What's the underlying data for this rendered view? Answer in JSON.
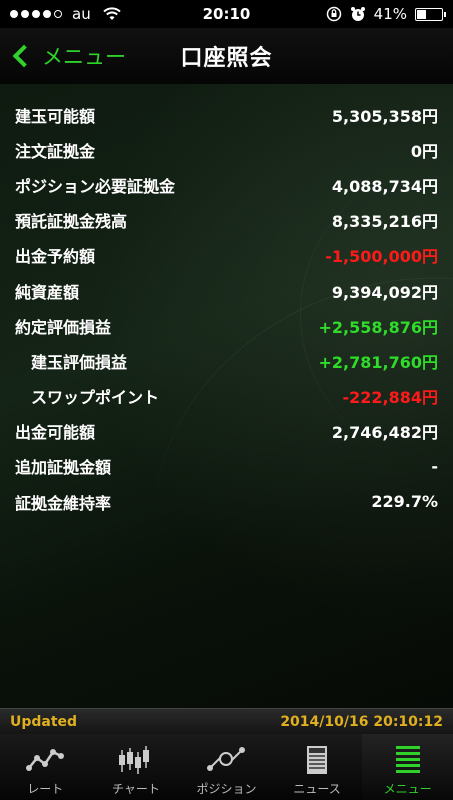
{
  "status": {
    "carrier": "au",
    "time": "20:10",
    "battery": "41%",
    "battery_level": 0.41
  },
  "nav": {
    "back_label": "メニュー",
    "title": "口座照会"
  },
  "rows": [
    {
      "label": "建玉可能額",
      "value": "5,305,358円",
      "color": "white",
      "indent": false
    },
    {
      "label": "注文証拠金",
      "value": "0円",
      "color": "white",
      "indent": false
    },
    {
      "label": "ポジション必要証拠金",
      "value": "4,088,734円",
      "color": "white",
      "indent": false
    },
    {
      "label": "預託証拠金残高",
      "value": "8,335,216円",
      "color": "white",
      "indent": false
    },
    {
      "label": "出金予約額",
      "value": "-1,500,000円",
      "color": "red",
      "indent": false
    },
    {
      "label": "純資産額",
      "value": "9,394,092円",
      "color": "white",
      "indent": false
    },
    {
      "label": "約定評価損益",
      "value": "+2,558,876円",
      "color": "green",
      "indent": false
    },
    {
      "label": "建玉評価損益",
      "value": "+2,781,760円",
      "color": "green",
      "indent": true
    },
    {
      "label": "スワップポイント",
      "value": "-222,884円",
      "color": "red",
      "indent": true
    },
    {
      "label": "出金可能額",
      "value": "2,746,482円",
      "color": "white",
      "indent": false
    },
    {
      "label": "追加証拠金額",
      "value": "-",
      "color": "white",
      "indent": false
    },
    {
      "label": "証拠金維持率",
      "value": "229.7%",
      "color": "white",
      "indent": false
    }
  ],
  "updated": {
    "label": "Updated",
    "timestamp": "2014/10/16 20:10:12"
  },
  "tabs": [
    {
      "label": "レート",
      "icon": "rate-icon",
      "active": false
    },
    {
      "label": "チャート",
      "icon": "chart-icon",
      "active": false
    },
    {
      "label": "ポジション",
      "icon": "position-icon",
      "active": false
    },
    {
      "label": "ニュース",
      "icon": "news-icon",
      "active": false
    },
    {
      "label": "メニュー",
      "icon": "menu-icon",
      "active": true
    }
  ],
  "colors": {
    "accent_green": "#2fd12a",
    "value_red": "#ff1a1a",
    "updated_gold": "#e0b020"
  }
}
